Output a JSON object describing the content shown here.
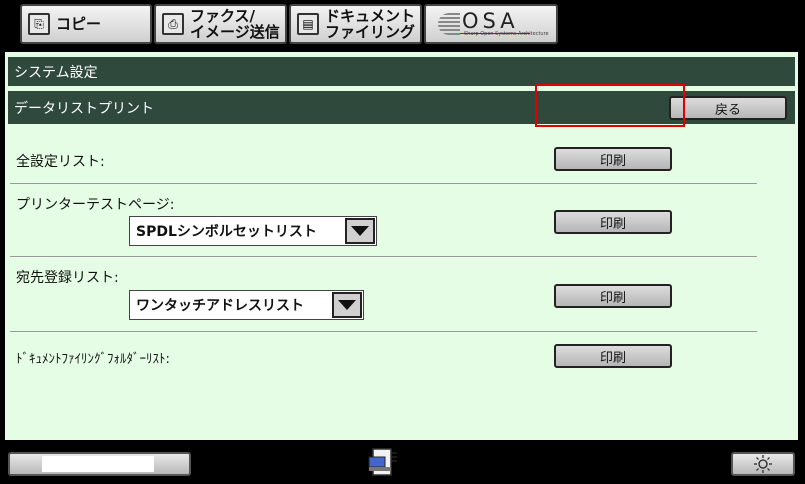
{
  "tabs": [
    {
      "label": "コピー",
      "icon": "copy-icon"
    },
    {
      "label": "ファクス/\nイメージ送信",
      "icon": "fax-icon"
    },
    {
      "label": "ドキュメント\nファイリング",
      "icon": "document-filing-icon"
    },
    {
      "label": "OSA",
      "sublabel": "Sharp Open Systems Architecture",
      "icon": "osa-logo"
    }
  ],
  "breadcrumb": {
    "system": "システム設定",
    "page": "データリストプリント"
  },
  "back_label": "戻る",
  "rows": [
    {
      "label": "全設定リスト:",
      "button": "印刷"
    },
    {
      "label": "プリンターテストページ:",
      "select": "SPDLシンボルセットリスト",
      "button": "印刷"
    },
    {
      "label": "宛先登録リスト:",
      "select": "ワンタッチアドレスリスト",
      "button": "印刷"
    },
    {
      "label": "ﾄﾞｷｭﾒﾝﾄﾌｧｲﾘﾝｸﾞﾌｫﾙﾀﾞｰﾘｽﾄ:",
      "button": "印刷"
    }
  ],
  "colors": {
    "panel_bg": "#e5fce5",
    "header_bg": "#2f4a3c",
    "highlight": "#e00000"
  }
}
